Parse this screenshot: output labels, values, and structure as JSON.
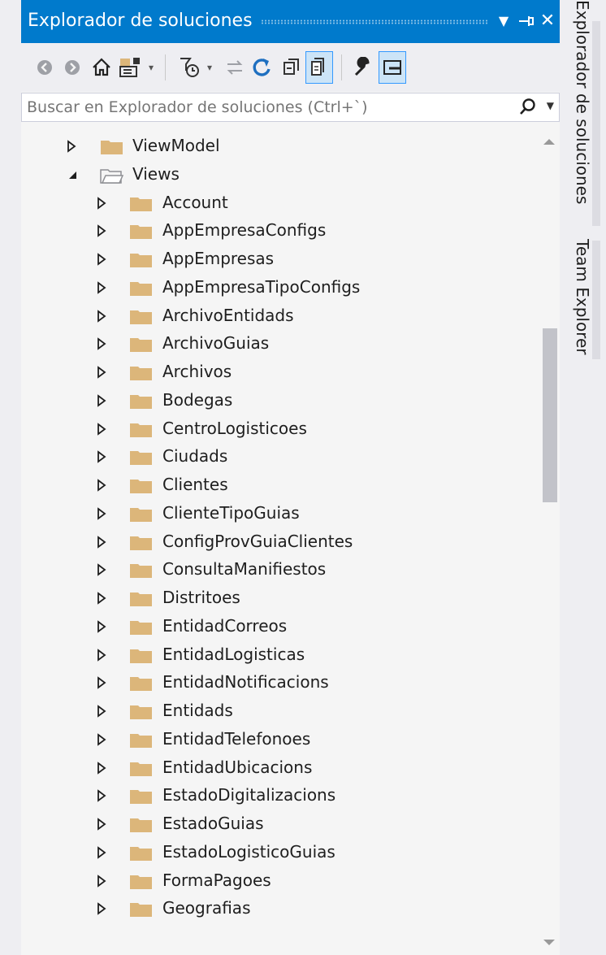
{
  "window": {
    "title": "Explorador de soluciones"
  },
  "title_buttons": {
    "menu_glyph": "▼",
    "pin_glyph": "⊣",
    "close_glyph": "✕"
  },
  "toolbar": {
    "icons": [
      "back-icon",
      "forward-icon",
      "home-icon",
      "switch-views-icon",
      "pending-changes-filter-icon",
      "sync-icon",
      "refresh-icon",
      "collapse-all-icon",
      "show-all-files-icon",
      "properties-icon",
      "preview-icon"
    ]
  },
  "search": {
    "placeholder": "Buscar en Explorador de soluciones (Ctrl+`)"
  },
  "tree": {
    "parents": [
      {
        "label": "ViewModel",
        "expanded": false
      },
      {
        "label": "Views",
        "expanded": true
      }
    ],
    "children": [
      "Account",
      "AppEmpresaConfigs",
      "AppEmpresas",
      "AppEmpresaTipoConfigs",
      "ArchivoEntidads",
      "ArchivoGuias",
      "Archivos",
      "Bodegas",
      "CentroLogisticoes",
      "Ciudads",
      "Clientes",
      "ClienteTipoGuias",
      "ConfigProvGuiaClientes",
      "ConsultaManifiestos",
      "Distritoes",
      "EntidadCorreos",
      "EntidadLogisticas",
      "EntidadNotificacions",
      "Entidads",
      "EntidadTelefonoes",
      "EntidadUbicacions",
      "EstadoDigitalizacions",
      "EstadoGuias",
      "EstadoLogisticoGuias",
      "FormaPagoes",
      "Geografias"
    ]
  },
  "side_tabs": [
    "Explorador de soluciones",
    "Team Explorer"
  ],
  "colors": {
    "accent": "#007acc",
    "folder": "#dcb67a",
    "background": "#f5f5f5"
  }
}
